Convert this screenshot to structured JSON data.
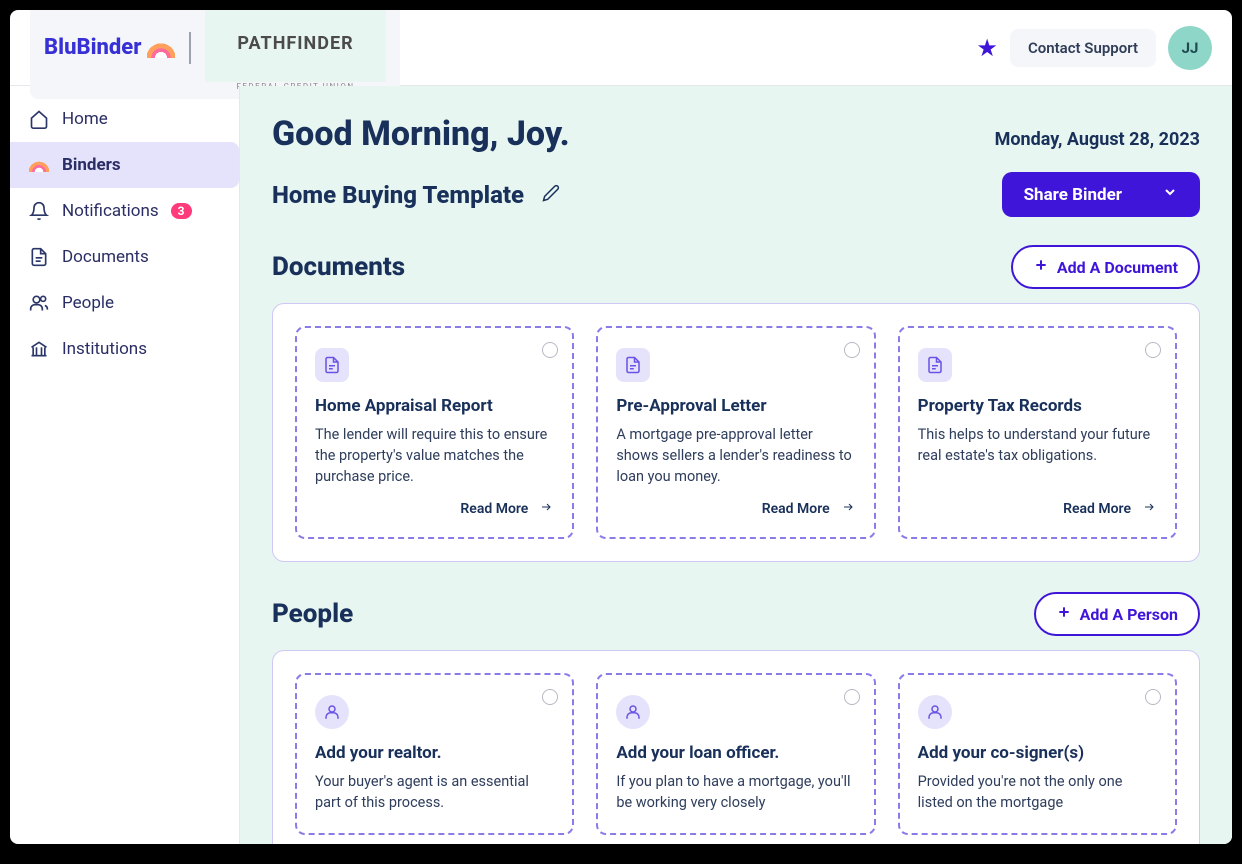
{
  "header": {
    "logo_primary": "BluBinder",
    "logo_partner_main": "PATHFINDER",
    "logo_partner_sub": "FEDERAL CREDIT UNION",
    "contact_support": "Contact Support",
    "avatar_initials": "JJ"
  },
  "sidebar": {
    "items": [
      {
        "label": "Home",
        "icon": "home-icon"
      },
      {
        "label": "Binders",
        "icon": "binders-icon",
        "active": true
      },
      {
        "label": "Notifications",
        "icon": "bell-icon",
        "badge": "3"
      },
      {
        "label": "Documents",
        "icon": "document-icon"
      },
      {
        "label": "People",
        "icon": "people-icon"
      },
      {
        "label": "Institutions",
        "icon": "institution-icon"
      }
    ]
  },
  "main": {
    "greeting": "Good Morning, Joy.",
    "date": "Monday, August 28, 2023",
    "binder_title": "Home Buying Template",
    "share_button": "Share Binder",
    "documents": {
      "title": "Documents",
      "add_label": "Add A Document",
      "cards": [
        {
          "title": "Home Appraisal Report",
          "desc": "The lender will require this to ensure the property's value matches the purchase price.",
          "more": "Read More"
        },
        {
          "title": "Pre-Approval Letter",
          "desc": "A mortgage pre-approval letter shows sellers a lender's readiness to loan you money.",
          "more": "Read More"
        },
        {
          "title": "Property Tax Records",
          "desc": "This helps to understand your future real estate's tax obligations.",
          "more": "Read More"
        }
      ]
    },
    "people": {
      "title": "People",
      "add_label": "Add A Person",
      "cards": [
        {
          "title": "Add your realtor.",
          "desc": "Your buyer's agent is an essential part of this process."
        },
        {
          "title": "Add your loan officer.",
          "desc": "If you plan to have a mortgage, you'll be working very closely"
        },
        {
          "title": "Add your co-signer(s)",
          "desc": "Provided you're not the only one listed on the mortgage"
        }
      ]
    }
  }
}
